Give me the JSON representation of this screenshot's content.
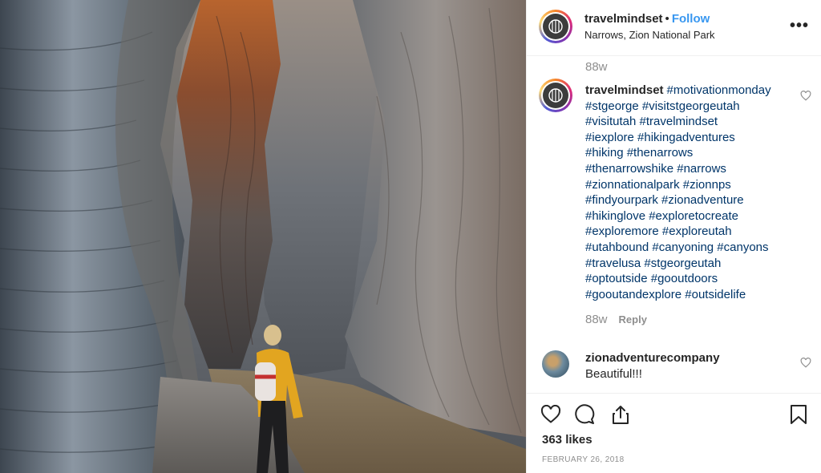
{
  "post": {
    "photo_alt": "Hiker in yellow jacket looking up at canyon walls",
    "colors": {
      "accent": "#3897f0",
      "hashtag": "#003569",
      "muted": "#8e8e8e",
      "text": "#262626"
    }
  },
  "header": {
    "username": "travelmindset",
    "separator": "•",
    "follow_label": "Follow",
    "location": "Narrows, Zion National Park",
    "more_icon": "more-horizontal-icon",
    "more_label": "•••"
  },
  "top_time": "88w",
  "caption": {
    "username": "travelmindset",
    "lines": [
      "#motivationmonday",
      "#stgeorge #visitstgeorgeutah",
      "#visitutah #travelmindset",
      "#iexplore #hikingadventures",
      "#hiking #thenarrows",
      "#thenarrowshike #narrows",
      "#zionnationalpark #zionnps",
      "#findyourpark #zionadventure",
      "#hikinglove #exploretocreate",
      "#exploremore #exploreutah",
      "#utahbound #canyoning #canyons",
      "#travelusa #stgeorgeutah",
      "#optoutside #gooutdoors",
      "#gooutandexplore #outsidelife"
    ],
    "time": "88w",
    "reply_label": "Reply"
  },
  "comment": {
    "username": "zionadventurecompany",
    "text": "Beautiful!!!"
  },
  "actions": {
    "like_icon": "heart-icon",
    "comment_icon": "comment-icon",
    "share_icon": "share-icon",
    "save_icon": "bookmark-icon",
    "likes": "363 likes",
    "date": "FEBRUARY 26, 2018"
  }
}
